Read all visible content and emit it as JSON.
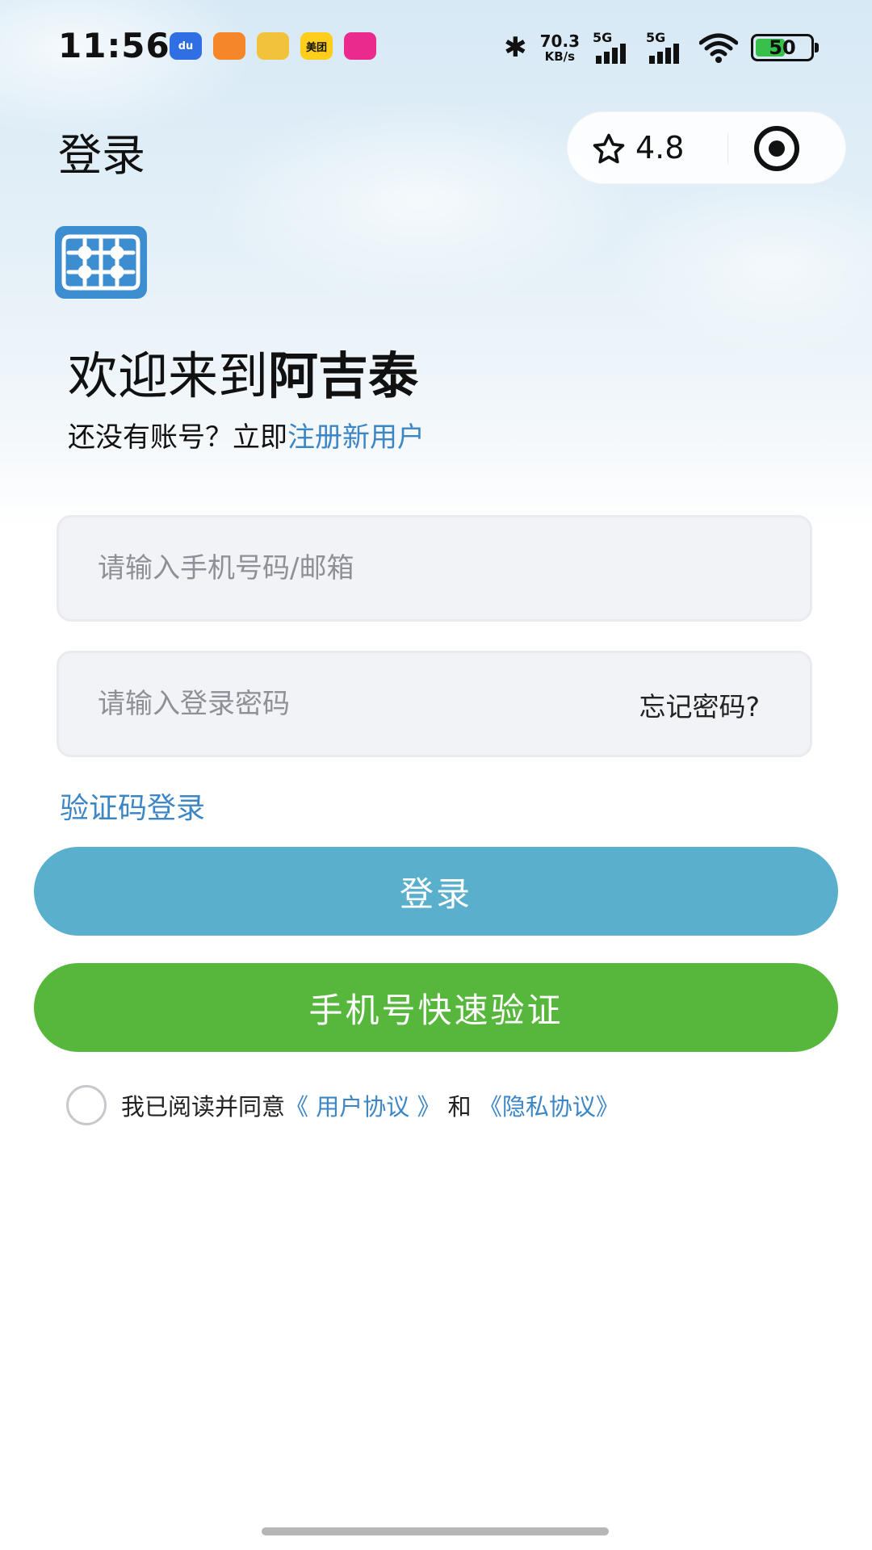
{
  "status_bar": {
    "time": "11:56",
    "apps": [
      {
        "name": "baidu-app-icon",
        "label": "du",
        "color": "#2f6fe3"
      },
      {
        "name": "orange-app-icon",
        "label": "",
        "color": "#f5862a"
      },
      {
        "name": "yellow-app-icon",
        "label": "",
        "color": "#f3c23c"
      },
      {
        "name": "meituan-app-icon",
        "label": "美团",
        "color": "#ffcd1c"
      },
      {
        "name": "pink-app-icon",
        "label": "",
        "color": "#ea2a8c"
      }
    ],
    "net_speed_value": "70.3",
    "net_speed_unit": "KB/s",
    "signal1_label": "5G",
    "signal2_label": "5G",
    "battery_level": "50"
  },
  "header": {
    "title": "登录",
    "rating": "4.8"
  },
  "welcome": {
    "prefix": "欢迎来到",
    "app_name": "阿吉泰"
  },
  "register": {
    "prompt": "还没有账号？立即",
    "link": "注册新用户"
  },
  "form": {
    "account_placeholder": "请输入手机号码/邮箱",
    "password_placeholder": "请输入登录密码",
    "forgot_label": "忘记密码?",
    "code_login_label": "验证码登录",
    "login_button": "登录",
    "quick_verify_button": "手机号快速验证"
  },
  "agreement": {
    "prefix": "我已阅读并同意",
    "user_agreement": "《 用户协议 》",
    "and": " 和 ",
    "privacy_policy": "《隐私协议》"
  },
  "colors": {
    "accent_blue": "#3d86c6",
    "login_button": "#5aafcd",
    "quick_button": "#57b73d",
    "logo_blue": "#3c8ed0"
  }
}
